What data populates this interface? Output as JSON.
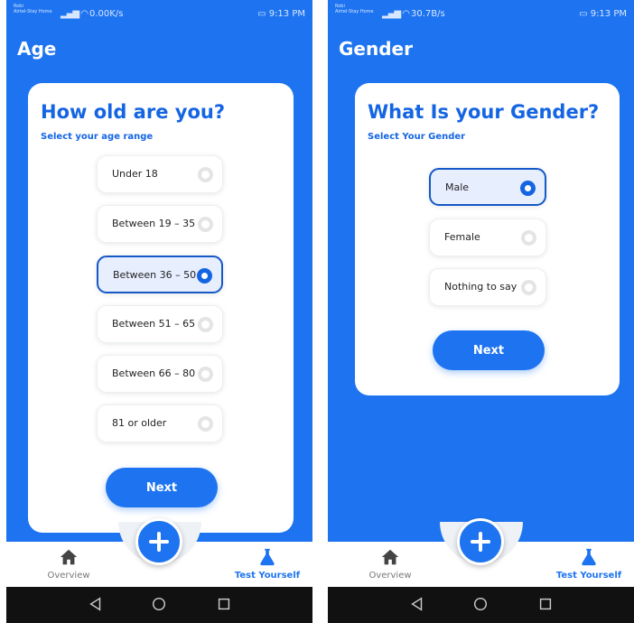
{
  "colors": {
    "primary_blue": "#1e74f0",
    "heading_blue": "#1565e3",
    "selected_border": "#1558c7",
    "selected_fill": "#e7efff"
  },
  "screens": [
    {
      "status": {
        "carrier_top": "Robi",
        "carrier_bottom": "Airtel-Stay Home",
        "speed": "0.00K/s",
        "time": "9:13 PM"
      },
      "title": "Age",
      "heading": "How old are you?",
      "subheading": "Select your age range",
      "options": [
        {
          "label": "Under 18",
          "selected": false
        },
        {
          "label": "Between 19 – 35",
          "selected": false
        },
        {
          "label": "Between 36 – 50",
          "selected": true
        },
        {
          "label": "Between 51 – 65",
          "selected": false
        },
        {
          "label": "Between 66 – 80",
          "selected": false
        },
        {
          "label": "81 or older",
          "selected": false
        }
      ],
      "next_label": "Next",
      "nav": {
        "overview": "Overview",
        "test_yourself": "Test Yourself",
        "add_icon": "plus-icon",
        "overview_icon": "home-icon",
        "test_icon": "flask-icon"
      }
    },
    {
      "status": {
        "carrier_top": "Robi",
        "carrier_bottom": "Airtel-Stay Home",
        "speed": "30.7B/s",
        "time": "9:13 PM"
      },
      "title": "Gender",
      "heading": "What Is your Gender?",
      "subheading": "Select Your Gender",
      "options": [
        {
          "label": "Male",
          "selected": true
        },
        {
          "label": "Female",
          "selected": false
        },
        {
          "label": "Nothing to say",
          "selected": false
        }
      ],
      "next_label": "Next",
      "nav": {
        "overview": "Overview",
        "test_yourself": "Test Yourself",
        "add_icon": "plus-icon",
        "overview_icon": "home-icon",
        "test_icon": "flask-icon"
      }
    }
  ]
}
